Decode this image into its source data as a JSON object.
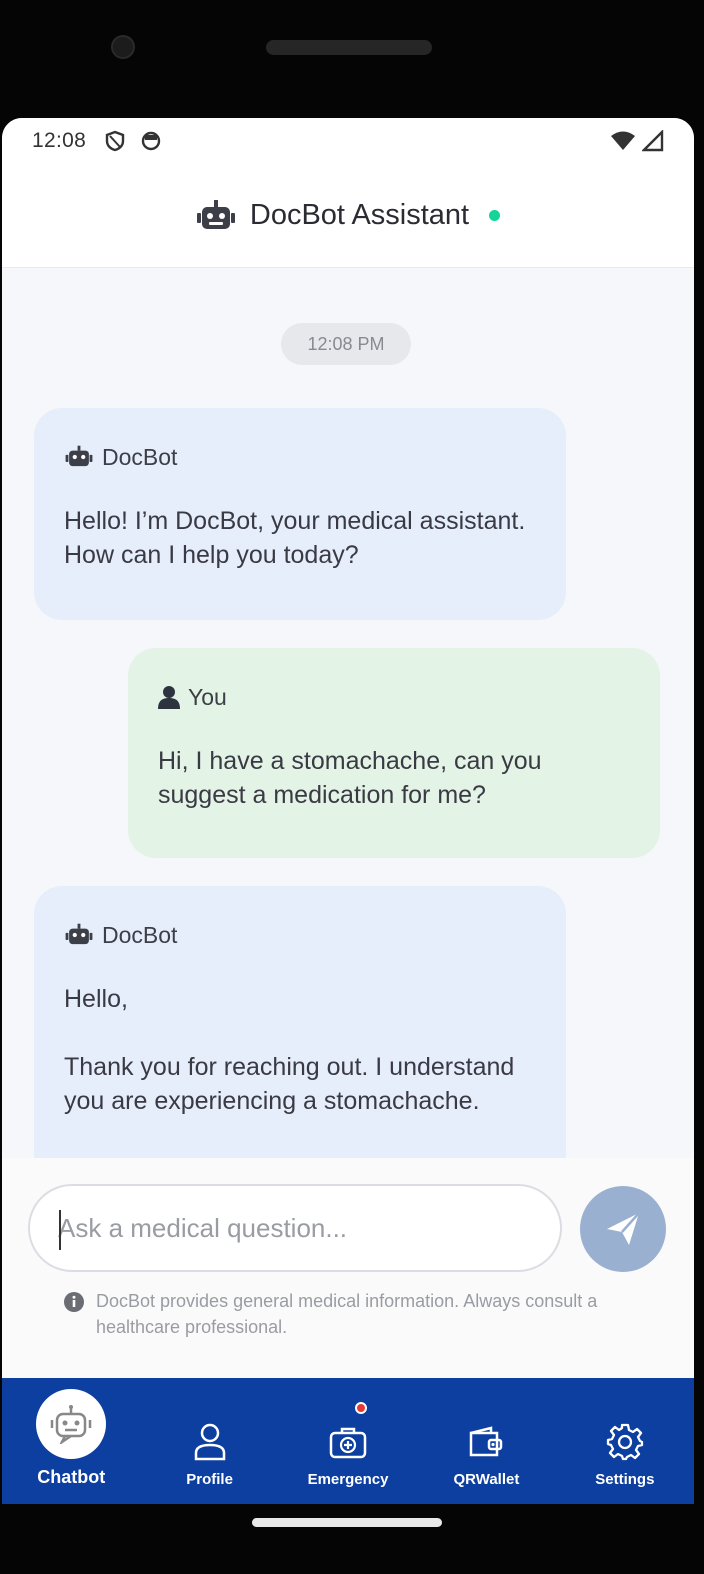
{
  "status_bar": {
    "time": "12:08"
  },
  "header": {
    "title": "DocBot Assistant",
    "bot_icon": "robot-icon"
  },
  "chat": {
    "timestamp": "12:08 PM",
    "messages": [
      {
        "sender": "DocBot",
        "lines": [
          "Hello! I’m DocBot, your medical assistant. How can I help you today?"
        ]
      },
      {
        "sender": "You",
        "lines": [
          "Hi, I have a stomachache, can you suggest a medication for me?"
        ]
      },
      {
        "sender": "DocBot",
        "lines": [
          "Hello,",
          "Thank you for reaching out. I understand you are experiencing a stomachache."
        ]
      }
    ]
  },
  "composer": {
    "placeholder": "Ask a medical question...",
    "disclaimer": "DocBot provides general medical information. Always consult a healthcare professional."
  },
  "nav": {
    "items": [
      {
        "label": "Chatbot",
        "icon": "robot-icon",
        "active": true
      },
      {
        "label": "Profile",
        "icon": "user-icon"
      },
      {
        "label": "Emergency",
        "icon": "medical-kit-icon",
        "badge": true
      },
      {
        "label": "QRWallet",
        "icon": "wallet-icon"
      },
      {
        "label": "Settings",
        "icon": "gear-icon"
      }
    ]
  },
  "colors": {
    "nav_bg": "#0d3fa0",
    "bot_bubble": "#e6eefb",
    "user_bubble": "#e3f3e5",
    "online": "#16d39a"
  }
}
